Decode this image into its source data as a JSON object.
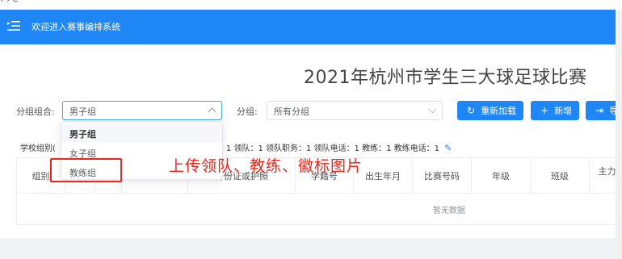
{
  "header": {
    "title": "欢迎进入赛事编排系统"
  },
  "page_title": "2021年杭州市学生三大球足球比赛",
  "filters": {
    "group_combo_label": "分组组合:",
    "group_combo_value": "男子组",
    "group_label": "分组:",
    "group_value": "所有分组"
  },
  "buttons": {
    "reload": "重新加载",
    "add": "新增",
    "export": "导"
  },
  "dropdown": {
    "options": [
      "男子组",
      "女子组",
      "教练组"
    ]
  },
  "info": {
    "prefix": "学校组别(",
    "text": "电话：1 领队：1 领队职务：1 领队电话：1 教练：1 教练电话：1"
  },
  "table": {
    "headers": [
      "组别",
      "",
      "",
      "",
      "身份证或护照",
      "学籍号",
      "出生年月",
      "比赛号码",
      "年级",
      "班级",
      "主力"
    ],
    "empty_text": "暂无数据"
  },
  "annotation": "上传领队、教练、徽标图片"
}
